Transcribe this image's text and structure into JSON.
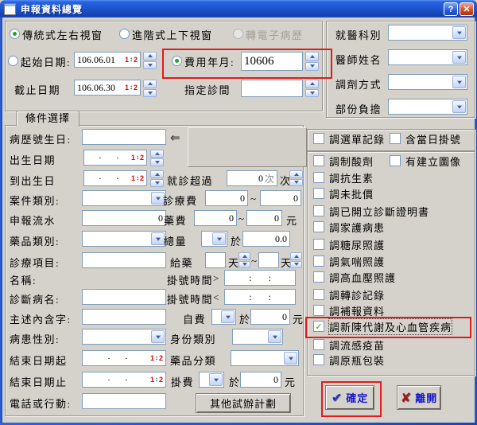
{
  "window": {
    "title": "申報資料總覽"
  },
  "titlebar": {
    "help": "?",
    "close": "✕"
  },
  "icons": {
    "date1": "1",
    "date_arrow": "↕",
    "date2": "2",
    "back_arrow": "⇐",
    "check": "✓",
    "ok_glyph": "✔",
    "exit_glyph": "✘"
  },
  "view": {
    "traditional": "傳統式左右視窗",
    "advanced": "進階式上下視窗",
    "electronic": "轉電子病歷"
  },
  "top": {
    "start_label": "起始日期:",
    "start_value": "106.06.01",
    "stop_label": "截止日期",
    "stop_value": "106.06.30",
    "fee_label": "費用年月:",
    "fee_value": "10606",
    "room_label": "指定診間",
    "dept_label": "就醫科別",
    "doctor_label": "醫師姓名",
    "dispense_label": "調劑方式",
    "copay_label": "部份負擔"
  },
  "tab": {
    "label": "條件選擇"
  },
  "left": {
    "chart_birth": "病歷號生日:",
    "birth_date": "出生日期",
    "to_birth": "到出生日",
    "case_type": "案件類別:",
    "serial": "申報流水",
    "serial_value": "0",
    "drug_type": "藥品類別:",
    "treat_item": "診療項目:",
    "name": "名稱:",
    "diagnosis": "診斷病名:",
    "complaint": "主述內含字:",
    "gender": "病患性別:",
    "end_from": "結束日期起",
    "end_to": "結束日期止",
    "phone": "電話或行動:",
    "empty_date": "·      ·"
  },
  "mid": {
    "visits": "就診超過",
    "visits_value": "0",
    "visits_inner_unit": "次",
    "visits_unit": "次",
    "consult": "診療費",
    "consult_from": "0",
    "consult_to": "0",
    "drugfee": "藥費",
    "drug_from": "0",
    "drug_to": "0",
    "total": "總量",
    "total_value": "0.0",
    "dispense": "給藥",
    "day": "天",
    "regtime": "掛號時間",
    "gt": ">",
    "lt": "<",
    "time_empty": ":       :",
    "selfpay": "自費",
    "selfpay_value": "0",
    "identity": "身份類別",
    "drugclass": "藥品分類",
    "regfee": "掛費",
    "regfee_value": "0",
    "tilde": "~",
    "at": "於",
    "yuan": "元"
  },
  "checks": {
    "row_menu": "調選單記錄",
    "row_today": "含當日掛號",
    "antacid": "調制酸劑",
    "image": "有建立圖像",
    "antibiotic": "調抗生素",
    "unbilled": "調未批價",
    "certificate": "調已開立診斷證明書",
    "homecare": "調家護病患",
    "diabetes": "調糖尿照護",
    "asthma": "調氣喘照護",
    "hypertension": "調高血壓照護",
    "referral": "調轉診記錄",
    "supplement": "調補報資料",
    "metabolic": "調新陳代謝及心血管疾病",
    "flu": "調流感疫苗",
    "bottle": "調原瓶包裝"
  },
  "buttons": {
    "other": "其他試辦計劃",
    "ok": "確定",
    "exit": "離開"
  },
  "colors": {
    "annotation": "#e01c1c",
    "titlebar": "#1f55d2",
    "body": "#d5d2cb",
    "input_border": "#7f9db9"
  }
}
